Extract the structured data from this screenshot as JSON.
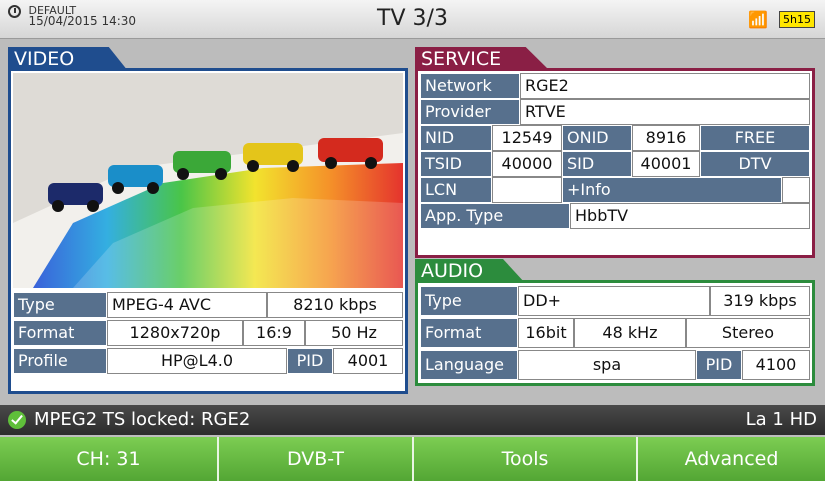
{
  "topbar": {
    "profile": "DEFAULT",
    "datetime": "15/04/2015 14:30",
    "title": "TV 3/3",
    "battery": "5h15"
  },
  "video": {
    "tab": "VIDEO",
    "rows": {
      "type_label": "Type",
      "type_value": "MPEG-4 AVC",
      "bitrate": "8210 kbps",
      "format_label": "Format",
      "resolution": "1280x720p",
      "aspect": "16:9",
      "frequency": "50 Hz",
      "profile_label": "Profile",
      "profile_value": "HP@L4.0",
      "pid_label": "PID",
      "pid_value": "4001"
    }
  },
  "service": {
    "tab": "SERVICE",
    "network_label": "Network",
    "network": "RGE2",
    "provider_label": "Provider",
    "provider": "RTVE",
    "nid_label": "NID",
    "nid": "12549",
    "onid_label": "ONID",
    "onid": "8916",
    "scrambling": "FREE",
    "tsid_label": "TSID",
    "tsid": "40000",
    "sid_label": "SID",
    "sid": "40001",
    "service_type": "DTV",
    "lcn_label": "LCN",
    "lcn": "",
    "more_info": "+Info",
    "apptype_label": "App. Type",
    "apptype": "HbbTV"
  },
  "audio": {
    "tab": "AUDIO",
    "type_label": "Type",
    "type_value": "DD+",
    "bitrate": "319 kbps",
    "format_label": "Format",
    "bits": "16bit",
    "rate": "48 kHz",
    "mode": "Stereo",
    "language_label": "Language",
    "language": "spa",
    "pid_label": "PID",
    "pid_value": "4100"
  },
  "status": {
    "message": "MPEG2 TS locked: RGE2",
    "channel_name": "La 1 HD"
  },
  "softkeys": [
    "CH: 31",
    "DVB-T",
    "Tools",
    "Advanced"
  ],
  "colors": {
    "video": "#1f4d8e",
    "service": "#8a1f45",
    "audio": "#2c8c3d",
    "label_bg": "#57708d",
    "softkey": "#62b13e"
  }
}
